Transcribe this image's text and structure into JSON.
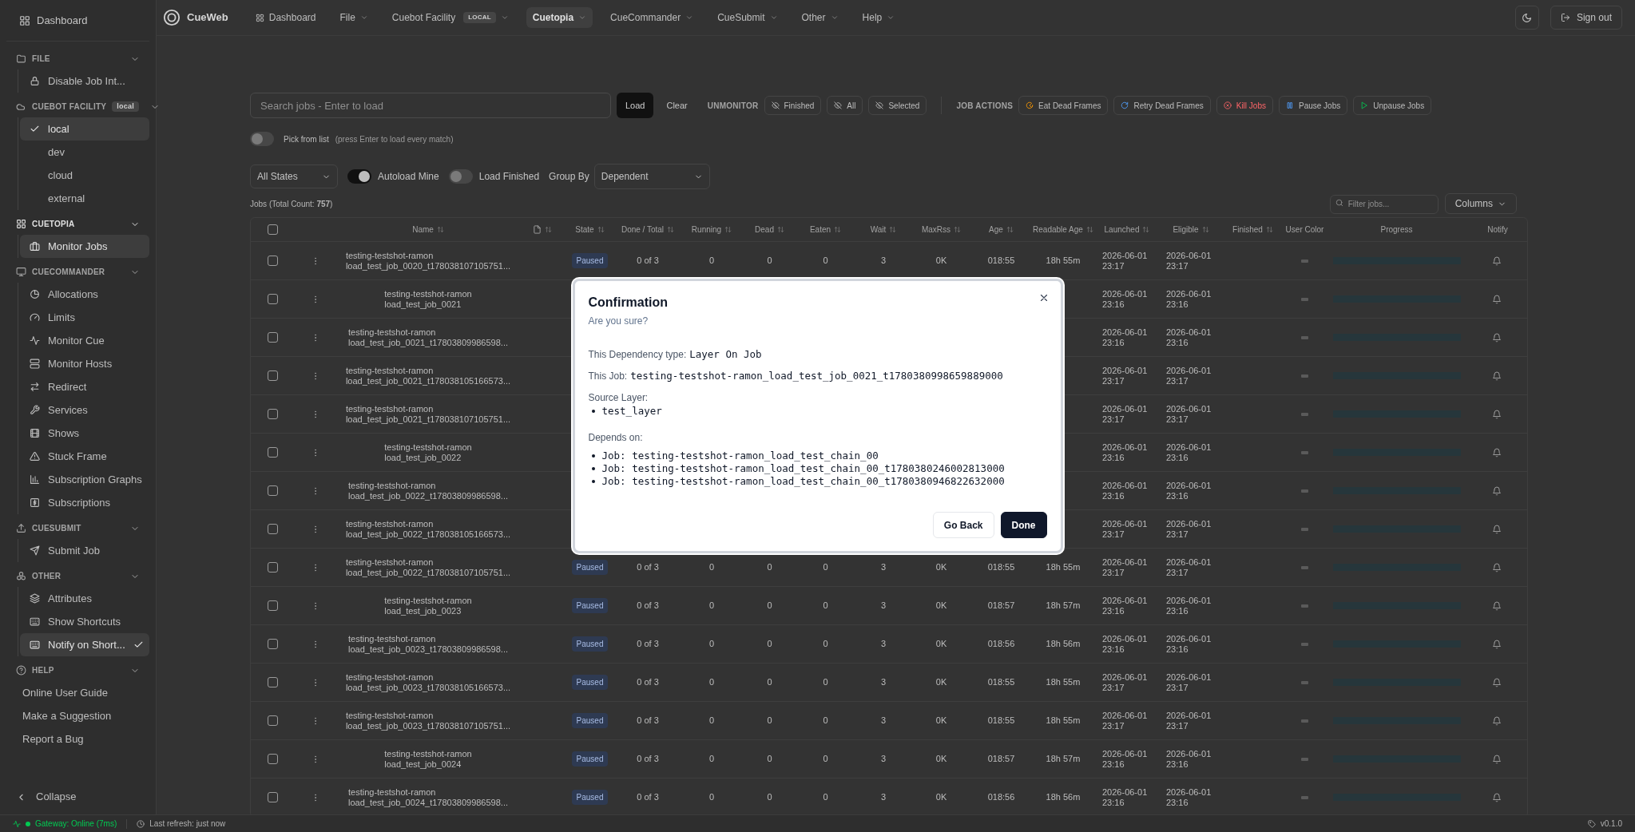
{
  "sidebar": {
    "dashboard": "Dashboard",
    "sections": [
      {
        "title": "FILE",
        "expanded": true,
        "active": false,
        "items": [
          {
            "label": "Disable Job Int...",
            "kind": "link",
            "selected": false
          }
        ]
      },
      {
        "title": "CUEBOT FACILITY",
        "badge": "local",
        "expanded": true,
        "active": false,
        "items": [
          {
            "label": "local",
            "kind": "option",
            "selected": true
          },
          {
            "label": "dev",
            "kind": "option",
            "selected": false
          },
          {
            "label": "cloud",
            "kind": "option",
            "selected": false
          },
          {
            "label": "external",
            "kind": "option",
            "selected": false
          }
        ]
      },
      {
        "title": "CUETOPIA",
        "expanded": true,
        "active": true,
        "items": [
          {
            "label": "Monitor Jobs",
            "kind": "link",
            "selected": true
          }
        ]
      },
      {
        "title": "CUECOMMANDER",
        "expanded": true,
        "active": false,
        "items": [
          {
            "label": "Allocations",
            "kind": "link",
            "selected": false
          },
          {
            "label": "Limits",
            "kind": "link",
            "selected": false
          },
          {
            "label": "Monitor Cue",
            "kind": "link",
            "selected": false
          },
          {
            "label": "Monitor Hosts",
            "kind": "link",
            "selected": false
          },
          {
            "label": "Redirect",
            "kind": "link",
            "selected": false
          },
          {
            "label": "Services",
            "kind": "link",
            "selected": false
          },
          {
            "label": "Shows",
            "kind": "link",
            "selected": false
          },
          {
            "label": "Stuck Frame",
            "kind": "link",
            "selected": false
          },
          {
            "label": "Subscription Graphs",
            "kind": "link",
            "selected": false
          },
          {
            "label": "Subscriptions",
            "kind": "link",
            "selected": false
          }
        ]
      },
      {
        "title": "CUESUBMIT",
        "expanded": true,
        "active": false,
        "items": [
          {
            "label": "Submit Job",
            "kind": "link",
            "selected": false
          }
        ]
      },
      {
        "title": "OTHER",
        "expanded": true,
        "active": false,
        "items": [
          {
            "label": "Attributes",
            "kind": "link",
            "selected": false
          },
          {
            "label": "Show Shortcuts",
            "kind": "link",
            "selected": false
          },
          {
            "label": "Notify on Short...",
            "kind": "toggle",
            "selected": true
          }
        ]
      },
      {
        "title": "HELP",
        "expanded": true,
        "active": false,
        "items": [
          {
            "label": "Online User Guide",
            "kind": "plain",
            "selected": false
          },
          {
            "label": "Make a Suggestion",
            "kind": "plain",
            "selected": false
          },
          {
            "label": "Report a Bug",
            "kind": "plain",
            "selected": false
          }
        ]
      }
    ],
    "collapse": "Collapse"
  },
  "nav": {
    "brand": "CueWeb",
    "items": [
      {
        "label": "Dashboard",
        "kind": "link",
        "selected": false
      },
      {
        "label": "File",
        "kind": "menu",
        "selected": false
      },
      {
        "label": "Cuebot Facility",
        "kind": "menu",
        "badge": "LOCAL",
        "selected": false
      },
      {
        "label": "Cuetopia",
        "kind": "menu",
        "selected": true
      },
      {
        "label": "CueCommander",
        "kind": "menu",
        "selected": false
      },
      {
        "label": "CueSubmit",
        "kind": "menu",
        "selected": false
      },
      {
        "label": "Other",
        "kind": "menu",
        "selected": false
      },
      {
        "label": "Help",
        "kind": "menu",
        "selected": false
      }
    ],
    "sign_out": "Sign out"
  },
  "toolbar": {
    "search": {
      "placeholder": "Search jobs - Enter to load"
    },
    "load": "Load",
    "clear": "Clear",
    "unmonitor": {
      "label": "UNMONITOR",
      "buttons": [
        "Finished",
        "All",
        "Selected"
      ]
    },
    "job_actions": {
      "label": "JOB ACTIONS",
      "buttons": [
        {
          "label": "Eat Dead Frames",
          "kind": "eat"
        },
        {
          "label": "Retry Dead Frames",
          "kind": "retry"
        },
        {
          "label": "Kill Jobs",
          "kind": "kill"
        },
        {
          "label": "Pause Jobs",
          "kind": "pause"
        },
        {
          "label": "Unpause Jobs",
          "kind": "unpause"
        }
      ]
    }
  },
  "pick_from_list": {
    "on": false,
    "label": "Pick from list",
    "hint": "(press Enter to load every match)"
  },
  "filters": {
    "state": "All States",
    "autoload": {
      "on": true,
      "label": "Autoload Mine"
    },
    "load_finished": {
      "on": false,
      "label": "Load Finished"
    },
    "group_by": {
      "label": "Group By",
      "value": "Dependent"
    }
  },
  "jobs_count": "Jobs (Total Count: **757**)",
  "filter": {
    "placeholder": "Filter jobs..."
  },
  "columns_button": "Columns",
  "table": {
    "select_all": false,
    "columns": [
      {
        "label": "Name",
        "sortable": true
      },
      {
        "kind": "icon",
        "sortable": true
      },
      {
        "label": "State",
        "sortable": true
      },
      {
        "label": "Done / Total",
        "sortable": true
      },
      {
        "label": "Running",
        "sortable": true
      },
      {
        "label": "Dead",
        "sortable": true
      },
      {
        "label": "Eaten",
        "sortable": true
      },
      {
        "label": "Wait",
        "sortable": true
      },
      {
        "label": "MaxRss",
        "sortable": true
      },
      {
        "label": "Age",
        "sortable": true
      },
      {
        "label": "Readable Age",
        "sortable": true
      },
      {
        "label": "Launched",
        "sortable": true
      },
      {
        "label": "Eligible",
        "sortable": true
      },
      {
        "label": "Finished",
        "sortable": true
      },
      {
        "label": "User Color",
        "sortable": false
      },
      {
        "label": "Progress",
        "sortable": false
      },
      {
        "label": "Notify",
        "sortable": false
      }
    ],
    "rows": [
      {
        "selected": false,
        "show": "testing-testshot-ramon",
        "name": "load_test_job_0020_t178038107105751...",
        "state": "Paused",
        "done_total": "0 of 3",
        "running": "0",
        "dead": "0",
        "eaten": "0",
        "wait": "3",
        "maxrss": "0K",
        "age": "018:55",
        "readable_age": "18h 55m",
        "launched": "2026-06-01 23:17",
        "eligible": "2026-06-01 23:17",
        "level": 0
      },
      {
        "selected": false,
        "show": "testing-testshot-ramon",
        "name": "load_test_job_0021",
        "launched": "2026-06-01 23:16",
        "eligible": "2026-06-01 23:16",
        "level": 0
      },
      {
        "selected": false,
        "show": "testing-testshot-ramon",
        "name": "load_test_job_0021_t17803809986598...",
        "launched": "2026-06-01 23:16",
        "eligible": "2026-06-01 23:16",
        "level": 0
      },
      {
        "selected": false,
        "show": "testing-testshot-ramon",
        "name": "load_test_job_0021_t178038105166573...",
        "launched": "2026-06-01 23:17",
        "eligible": "2026-06-01 23:17",
        "level": 0
      },
      {
        "selected": false,
        "show": "testing-testshot-ramon",
        "name": "load_test_job_0021_t178038107105751...",
        "launched": "2026-06-01 23:17",
        "eligible": "2026-06-01 23:17",
        "level": 0
      },
      {
        "selected": false,
        "show": "testing-testshot-ramon",
        "name": "load_test_job_0022",
        "launched": "2026-06-01 23:16",
        "eligible": "2026-06-01 23:16",
        "level": 0
      },
      {
        "selected": false,
        "show": "testing-testshot-ramon",
        "name": "load_test_job_0022_t17803809986598...",
        "launched": "2026-06-01 23:16",
        "eligible": "2026-06-01 23:16",
        "level": 0
      },
      {
        "selected": false,
        "show": "testing-testshot-ramon",
        "name": "load_test_job_0022_t178038105166573...",
        "launched": "2026-06-01 23:17",
        "eligible": "2026-06-01 23:17",
        "level": 0
      },
      {
        "selected": false,
        "show": "testing-testshot-ramon",
        "name": "load_test_job_0022_t178038107105751...",
        "state": "Paused",
        "done_total": "0 of 3",
        "running": "0",
        "dead": "0",
        "eaten": "0",
        "wait": "3",
        "maxrss": "0K",
        "age": "018:55",
        "readable_age": "18h 55m",
        "launched": "2026-06-01 23:17",
        "eligible": "2026-06-01 23:17",
        "level": 0
      },
      {
        "selected": false,
        "show": "testing-testshot-ramon",
        "name": "load_test_job_0023",
        "state": "Paused",
        "done_total": "0 of 3",
        "running": "0",
        "dead": "0",
        "eaten": "0",
        "wait": "3",
        "maxrss": "0K",
        "age": "018:57",
        "readable_age": "18h 57m",
        "launched": "2026-06-01 23:16",
        "eligible": "2026-06-01 23:16",
        "level": 0
      },
      {
        "selected": false,
        "show": "testing-testshot-ramon",
        "name": "load_test_job_0023_t17803809986598...",
        "state": "Paused",
        "done_total": "0 of 3",
        "running": "0",
        "dead": "0",
        "eaten": "0",
        "wait": "3",
        "maxrss": "0K",
        "age": "018:56",
        "readable_age": "18h 56m",
        "launched": "2026-06-01 23:16",
        "eligible": "2026-06-01 23:16",
        "level": 0
      },
      {
        "selected": false,
        "show": "testing-testshot-ramon",
        "name": "load_test_job_0023_t178038105166573...",
        "state": "Paused",
        "done_total": "0 of 3",
        "running": "0",
        "dead": "0",
        "eaten": "0",
        "wait": "3",
        "maxrss": "0K",
        "age": "018:55",
        "readable_age": "18h 55m",
        "launched": "2026-06-01 23:17",
        "eligible": "2026-06-01 23:17",
        "level": 0
      },
      {
        "selected": false,
        "show": "testing-testshot-ramon",
        "name": "load_test_job_0023_t178038107105751...",
        "state": "Paused",
        "done_total": "0 of 3",
        "running": "0",
        "dead": "0",
        "eaten": "0",
        "wait": "3",
        "maxrss": "0K",
        "age": "018:55",
        "readable_age": "18h 55m",
        "launched": "2026-06-01 23:17",
        "eligible": "2026-06-01 23:17",
        "level": 0
      },
      {
        "selected": false,
        "show": "testing-testshot-ramon",
        "name": "load_test_job_0024",
        "state": "Paused",
        "done_total": "0 of 3",
        "running": "0",
        "dead": "0",
        "eaten": "0",
        "wait": "3",
        "maxrss": "0K",
        "age": "018:57",
        "readable_age": "18h 57m",
        "launched": "2026-06-01 23:16",
        "eligible": "2026-06-01 23:16",
        "level": 0
      },
      {
        "selected": false,
        "show": "testing-testshot-ramon",
        "name": "load_test_job_0024_t17803809986598...",
        "state": "Paused",
        "done_total": "0 of 3",
        "running": "0",
        "dead": "0",
        "eaten": "0",
        "wait": "3",
        "maxrss": "0K",
        "age": "018:56",
        "readable_age": "18h 56m",
        "launched": "2026-06-01 23:16",
        "eligible": "2026-06-01 23:16",
        "level": 0
      }
    ]
  },
  "status_bar": {
    "gateway": "Gateway: Online (7ms)",
    "last_refresh": "Last refresh: just now",
    "version": "v0.1.0"
  },
  "dialog": {
    "title": "Confirmation",
    "subtitle": "Are you sure?",
    "fields": [
      {
        "label": "This Dependency type:",
        "value": "Layer On Job"
      },
      {
        "label": "This Job:",
        "value": "testing-testshot-ramon_load_test_job_0021_t1780380998659889000"
      }
    ],
    "source_layer": {
      "label": "Source Layer:",
      "items": [
        "test_layer"
      ]
    },
    "depends_on": {
      "label": "Depends on:",
      "items": [
        "Job: testing-testshot-ramon_load_test_chain_00",
        "Job: testing-testshot-ramon_load_test_chain_00_t1780380246002813000",
        "Job: testing-testshot-ramon_load_test_chain_00_t1780380946822632000"
      ]
    },
    "buttons": [
      {
        "label": "Go Back",
        "kind": "secondary"
      },
      {
        "label": "Done",
        "kind": "primary"
      }
    ]
  }
}
